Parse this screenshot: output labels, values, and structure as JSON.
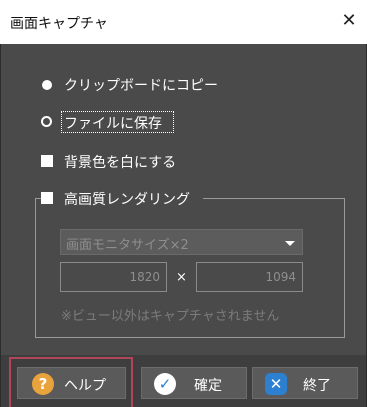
{
  "window": {
    "title": "画面キャプチャ",
    "close_glyph": "✕"
  },
  "options": {
    "clipboard_label": "クリップボードにコピー",
    "file_label": "ファイルに保存",
    "white_bg_label": "背景色を白にする",
    "hq_label": "高画質レンダリング",
    "selected": "file"
  },
  "hq": {
    "select_value": "画面モニタサイズ×2",
    "width": "1820",
    "times": "×",
    "height": "1094",
    "note": "※ビュー以外はキャプチャされません"
  },
  "buttons": {
    "help_label": "ヘルプ",
    "ok_label": "確定",
    "close_label": "終了"
  },
  "icons": {
    "help": "?",
    "ok": "✓",
    "close": "✕"
  },
  "colors": {
    "help_icon": "#e8a33c",
    "ok_icon": "#2d7fd0",
    "close_icon": "#2d7fd0",
    "help_highlight": "#b0465a"
  }
}
